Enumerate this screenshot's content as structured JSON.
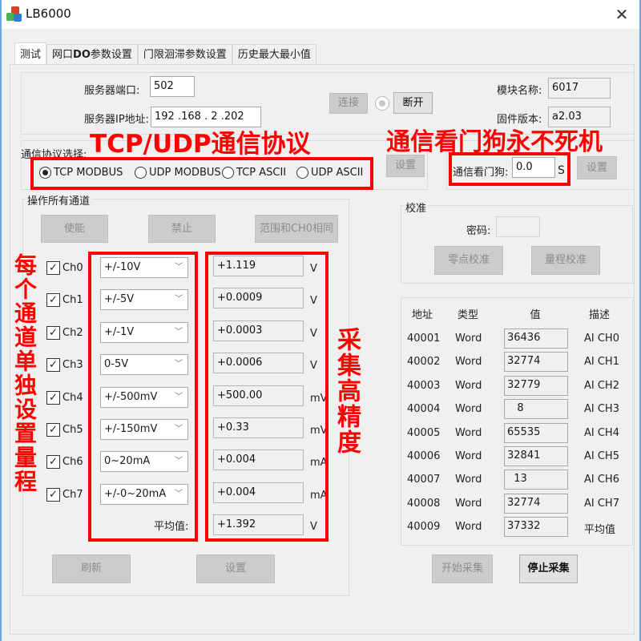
{
  "window": {
    "title": "LB6000",
    "close_glyph": "✕"
  },
  "tabs": [
    {
      "label": "测试",
      "active": true
    },
    {
      "label_pre": "网口",
      "label_bold": "DO",
      "label_post": "参数设置",
      "active": false
    },
    {
      "label": "门限洄滞参数设置",
      "active": false
    },
    {
      "label": "历史最大最小值",
      "active": false
    }
  ],
  "connection": {
    "port_label": "服务器端口:",
    "port_value": "502",
    "ip_label": "服务器IP地址:",
    "ip_value": "192 .168 .  2  .202",
    "connect_label": "连接",
    "disconnect_label": "断开",
    "module_name_label": "模块名称:",
    "module_name_value": "6017",
    "firmware_label": "固件版本:",
    "firmware_value": "a2.03"
  },
  "protocol": {
    "label": "通信协议选择:",
    "options": [
      {
        "label": "TCP MODBUS",
        "selected": true
      },
      {
        "label": "UDP MODBUS",
        "selected": false
      },
      {
        "label": "TCP ASCII",
        "selected": false
      },
      {
        "label": "UDP ASCII",
        "selected": false
      }
    ],
    "set_label": "设置"
  },
  "watchdog": {
    "label": "通信看门狗:",
    "value": "0.0",
    "unit": "S",
    "set_label": "设置"
  },
  "all_channels": {
    "title": "操作所有通道",
    "enable_label": "使能",
    "disable_label": "禁止",
    "same_range_label": "范围和CH0相同"
  },
  "channels": [
    {
      "name": "Ch0",
      "checked": true,
      "range": "+/-10V",
      "value": "+1.119",
      "unit": "V"
    },
    {
      "name": "Ch1",
      "checked": true,
      "range": "+/-5V",
      "value": "+0.0009",
      "unit": "V"
    },
    {
      "name": "Ch2",
      "checked": true,
      "range": "+/-1V",
      "value": "+0.0003",
      "unit": "V"
    },
    {
      "name": "Ch3",
      "checked": true,
      "range": "0-5V",
      "value": "+0.0006",
      "unit": "V"
    },
    {
      "name": "Ch4",
      "checked": true,
      "range": "+/-500mV",
      "value": "+500.00",
      "unit": "mV"
    },
    {
      "name": "Ch5",
      "checked": true,
      "range": "+/-150mV",
      "value": "+0.33",
      "unit": "mV"
    },
    {
      "name": "Ch6",
      "checked": true,
      "range": "0~20mA",
      "value": "+0.004",
      "unit": "mA"
    },
    {
      "name": "Ch7",
      "checked": true,
      "range": "+/-0~20mA",
      "value": "+0.004",
      "unit": "mA"
    }
  ],
  "average": {
    "label": "平均值:",
    "value": "+1.392",
    "unit": "V"
  },
  "bottom_buttons": {
    "refresh_label": "刷新",
    "set_label": "设置"
  },
  "calibration": {
    "title": "校准",
    "password_label": "密码:",
    "password_value": "",
    "zero_label": "零点校准",
    "span_label": "量程校准"
  },
  "register_table": {
    "headers": [
      "地址",
      "类型",
      "值",
      "描述"
    ],
    "rows": [
      {
        "addr": "40001",
        "type": "Word",
        "value": "36436",
        "desc": "AI CH0"
      },
      {
        "addr": "40002",
        "type": "Word",
        "value": "32774",
        "desc": "AI CH1"
      },
      {
        "addr": "40003",
        "type": "Word",
        "value": "32779",
        "desc": "AI CH2"
      },
      {
        "addr": "40004",
        "type": "Word",
        "value": "   8",
        "desc": "AI CH3"
      },
      {
        "addr": "40005",
        "type": "Word",
        "value": "65535",
        "desc": "AI CH4"
      },
      {
        "addr": "40006",
        "type": "Word",
        "value": "32841",
        "desc": "AI CH5"
      },
      {
        "addr": "40007",
        "type": "Word",
        "value": "  13",
        "desc": "AI CH6"
      },
      {
        "addr": "40008",
        "type": "Word",
        "value": "32774",
        "desc": "AI CH7"
      },
      {
        "addr": "40009",
        "type": "Word",
        "value": "37332",
        "desc": "平均值"
      }
    ]
  },
  "acquisition": {
    "start_label": "开始采集",
    "stop_label": "停止采集"
  },
  "annotations": {
    "protocol": "TCP/UDP通信协议",
    "watchdog": "通信看门狗永不死机",
    "per_channel_range": "每个通道单独设置量程",
    "high_precision": "采集高精度",
    "color": "#ff0000"
  }
}
